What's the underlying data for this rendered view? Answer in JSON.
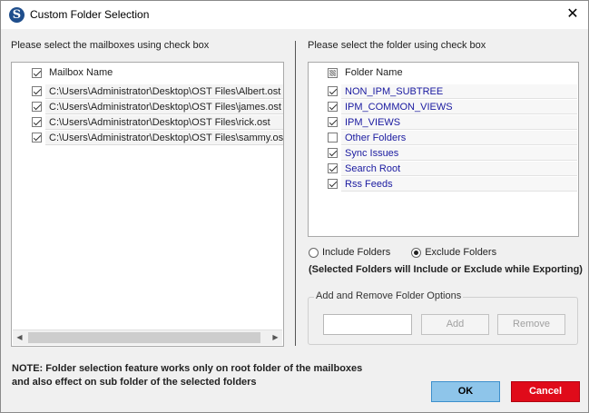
{
  "window": {
    "title": "Custom Folder Selection",
    "app_icon_letter": "S",
    "close_glyph": "✕"
  },
  "left": {
    "label": "Please select the mailboxes using check box",
    "header": "Mailbox Name",
    "items": [
      {
        "path": "C:\\Users\\Administrator\\Desktop\\OST Files\\Albert.ost",
        "checked": true
      },
      {
        "path": "C:\\Users\\Administrator\\Desktop\\OST Files\\james.ost",
        "checked": true
      },
      {
        "path": "C:\\Users\\Administrator\\Desktop\\OST Files\\rick.ost",
        "checked": true
      },
      {
        "path": "C:\\Users\\Administrator\\Desktop\\OST Files\\sammy.ost",
        "checked": true
      }
    ],
    "scroll_left": "◀",
    "scroll_right": "▶"
  },
  "right": {
    "label": "Please select the folder using check box",
    "header": "Folder Name",
    "items": [
      {
        "name": "NON_IPM_SUBTREE",
        "checked": true
      },
      {
        "name": "IPM_COMMON_VIEWS",
        "checked": true
      },
      {
        "name": "IPM_VIEWS",
        "checked": true
      },
      {
        "name": "Other Folders",
        "checked": false
      },
      {
        "name": "Sync Issues",
        "checked": true
      },
      {
        "name": "Search Root",
        "checked": true
      },
      {
        "name": "Rss Feeds",
        "checked": true
      }
    ],
    "include_label": "Include Folders",
    "exclude_label": "Exclude Folders",
    "selected_mode": "exclude",
    "mode_note": "(Selected Folders will Include or Exclude while Exporting)",
    "group_title": "Add and Remove Folder Options",
    "add_label": "Add",
    "remove_label": "Remove",
    "folder_input_value": ""
  },
  "footer": {
    "note_line1": "NOTE: Folder selection feature works only on root folder of the mailboxes",
    "note_line2": "and also effect on sub folder of the selected folders",
    "ok_label": "OK",
    "cancel_label": "Cancel"
  },
  "colors": {
    "ok_bg": "#8ec5ea",
    "cancel_bg": "#e00b1a",
    "folder_text": "#1a1aa0"
  }
}
